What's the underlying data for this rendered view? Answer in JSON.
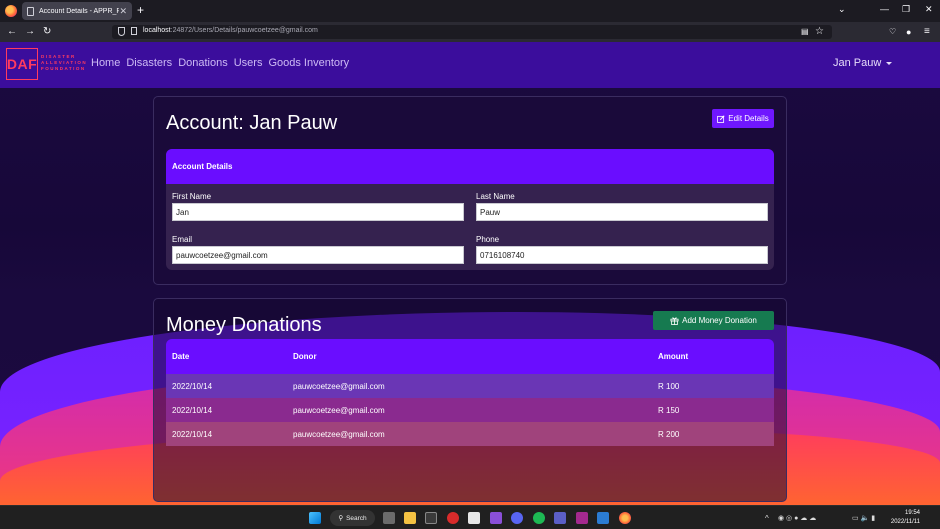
{
  "browser": {
    "tab_title": "Account Details - APPR_POE",
    "tab_close": "✕",
    "new_tab": "+",
    "url_host": "localhost",
    "url_rest": ":24872/Users/Details/pauwcoetzee@gmail.com",
    "back": "←",
    "forward": "→",
    "reload": "↻",
    "win_min": "—",
    "win_max": "❐",
    "win_close": "✕",
    "chevron": "⌄",
    "bookmark": "☆",
    "menu": "≡"
  },
  "site_nav": {
    "logo_letters": "DAF",
    "logo_line1": "DISASTER",
    "logo_line2": "ALLEVIATION",
    "logo_line3": "FOUNDATION",
    "links": [
      "Home",
      "Disasters",
      "Donations",
      "Users",
      "Goods Inventory"
    ],
    "user": "Jan Pauw"
  },
  "account": {
    "title": "Account: Jan Pauw",
    "edit_label": "Edit Details",
    "section_title": "Account Details",
    "first_name_label": "First Name",
    "first_name": "Jan",
    "last_name_label": "Last Name",
    "last_name": "Pauw",
    "email_label": "Email",
    "email": "pauwcoetzee@gmail.com",
    "phone_label": "Phone",
    "phone": "0716108740"
  },
  "donations": {
    "title": "Money Donations",
    "add_label": "Add Money Donation",
    "columns": [
      "Date",
      "Donor",
      "Amount"
    ],
    "rows": [
      {
        "date": "2022/10/14",
        "donor": "pauwcoetzee@gmail.com",
        "amount": "R 100"
      },
      {
        "date": "2022/10/14",
        "donor": "pauwcoetzee@gmail.com",
        "amount": "R 150"
      },
      {
        "date": "2022/10/14",
        "donor": "pauwcoetzee@gmail.com",
        "amount": "R 200"
      }
    ]
  },
  "taskbar": {
    "search_label": "Search",
    "time": "19:54",
    "date": "2022/11/11",
    "tray_chevron": "^"
  },
  "colors": {
    "nav_bg": "#3b0d9c",
    "accent_purple": "#6a0dff",
    "edit_button": "#6f17ff",
    "add_button": "#167a50",
    "logo_red": "#ff3b5f"
  }
}
